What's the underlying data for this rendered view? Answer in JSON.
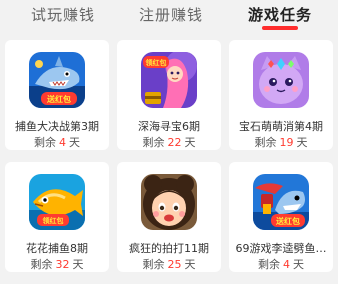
{
  "tabs": [
    {
      "label": "试玩赚钱"
    },
    {
      "label": "注册赚钱"
    },
    {
      "label": "游戏任务"
    }
  ],
  "active_tab": 2,
  "accent_color": "#ff2d2d",
  "games": [
    {
      "name": "捕鱼大决战第3期",
      "prefix": "剩余",
      "days": "4",
      "suffix": "天",
      "icon": "shark-fishing-icon",
      "badge": "送红包"
    },
    {
      "name": "深海寻宝6期",
      "prefix": "剩余",
      "days": "22",
      "suffix": "天",
      "icon": "mermaid-treasure-icon",
      "badge": "领红包"
    },
    {
      "name": "宝石萌萌消第4期",
      "prefix": "剩余",
      "days": "19",
      "suffix": "天",
      "icon": "purple-cat-gem-icon",
      "badge": ""
    },
    {
      "name": "花花捕鱼8期",
      "prefix": "剩余",
      "days": "32",
      "suffix": "天",
      "icon": "golden-fish-icon",
      "badge": "领红包"
    },
    {
      "name": "疯狂的拍打11期",
      "prefix": "剩余",
      "days": "25",
      "suffix": "天",
      "icon": "cartoon-girl-icon",
      "badge": ""
    },
    {
      "name": "69游戏李逵劈鱼…",
      "prefix": "剩余",
      "days": "4",
      "suffix": "天",
      "icon": "shark-cannon-icon",
      "badge": "送红包"
    }
  ]
}
